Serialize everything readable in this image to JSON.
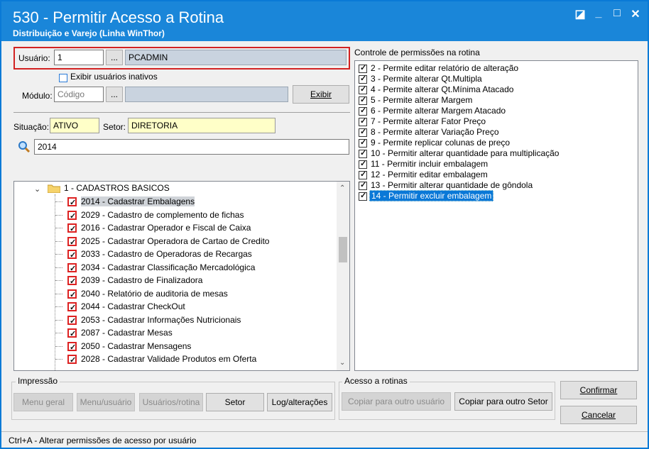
{
  "window": {
    "title": "530 - Permitir Acesso a Rotina",
    "subtitle": "Distribuição e Varejo (Linha WinThor)",
    "controls": {
      "restore": "◪",
      "minimize": "_",
      "maximize": "□",
      "close": "✕"
    }
  },
  "user": {
    "label": "Usuário:",
    "code": "1",
    "browse_label": "...",
    "name": "PCADMIN",
    "show_inactive_label": "Exibir usuários inativos"
  },
  "module": {
    "label": "Módulo:",
    "placeholder": "Código",
    "browse_label": "...",
    "exibir_label": "Exibir"
  },
  "situacao": {
    "label": "Situação:",
    "value": "ATIVO"
  },
  "setor": {
    "label": "Setor:",
    "value": "DIRETORIA"
  },
  "search": {
    "value": "2014"
  },
  "tree": {
    "folder_label": "1 - CADASTROS BASICOS",
    "items": [
      {
        "label": "2014 - Cadastrar Embalagens",
        "checked": true,
        "selected": true
      },
      {
        "label": "2029 - Cadastro de complemento de fichas",
        "checked": true
      },
      {
        "label": "2016 - Cadastrar Operador e Fiscal de Caixa",
        "checked": true
      },
      {
        "label": "2025 - Cadastrar Operadora de Cartao de Credito",
        "checked": true
      },
      {
        "label": "2033 - Cadastro de Operadoras de Recargas",
        "checked": true
      },
      {
        "label": "2034 - Cadastrar Classificação Mercadológica",
        "checked": true
      },
      {
        "label": "2039 - Cadastro de Finalizadora",
        "checked": true
      },
      {
        "label": "2040 - Relatório de auditoria de mesas",
        "checked": true
      },
      {
        "label": "2044 - Cadastrar CheckOut",
        "checked": true
      },
      {
        "label": "2053 - Cadastrar Informações Nutricionais",
        "checked": true
      },
      {
        "label": "2087 - Cadastrar Mesas",
        "checked": true
      },
      {
        "label": "2050 - Cadastrar Mensagens",
        "checked": true
      },
      {
        "label": "2028 - Cadastrar Validade Produtos em Oferta",
        "checked": true
      }
    ]
  },
  "permissions": {
    "title": "Controle de permissões na rotina",
    "items": [
      {
        "label": "2 - Permite editar relatório de alteração",
        "checked": true
      },
      {
        "label": "3 - Permite alterar Qt.Multipla",
        "checked": true
      },
      {
        "label": "4 - Permite alterar Qt.Mínima Atacado",
        "checked": true
      },
      {
        "label": "5 - Permite alterar Margem",
        "checked": true
      },
      {
        "label": "6 - Permite alterar Margem Atacado",
        "checked": true
      },
      {
        "label": "7 - Permite alterar Fator Preço",
        "checked": true
      },
      {
        "label": "8 - Permite alterar Variação Preço",
        "checked": true
      },
      {
        "label": "9 - Permite replicar colunas de preço",
        "checked": true
      },
      {
        "label": "10 - Permitir alterar quantidade para multiplicação",
        "checked": true
      },
      {
        "label": "11 - Permitir incluir embalagem",
        "checked": true
      },
      {
        "label": "12 - Permitir editar embalagem",
        "checked": true
      },
      {
        "label": "13 - Permitir alterar quantidade de gôndola",
        "checked": true
      },
      {
        "label": "14 - Permitir excluir embalagem",
        "checked": true,
        "selected": true
      }
    ]
  },
  "impressao": {
    "title": "Impressão",
    "menu_geral": "Menu geral",
    "menu_usuario": "Menu/usuário",
    "usuarios_rotina": "Usuários/rotina",
    "setor": "Setor",
    "log": "Log/alterações"
  },
  "acesso": {
    "title": "Acesso a rotinas",
    "copiar_usuario": "Copiar para outro usuário",
    "copiar_setor": "Copiar para outro Setor"
  },
  "actions": {
    "confirmar": "Confirmar",
    "cancelar": "Cancelar"
  },
  "status": {
    "text": "Ctrl+A - Alterar permissões de acesso por usuário"
  },
  "colors": {
    "titlebar": "#1a86d9",
    "selection": "#0a78d7",
    "highlight_border": "#d22222",
    "yellow_field": "#ffffc8"
  }
}
